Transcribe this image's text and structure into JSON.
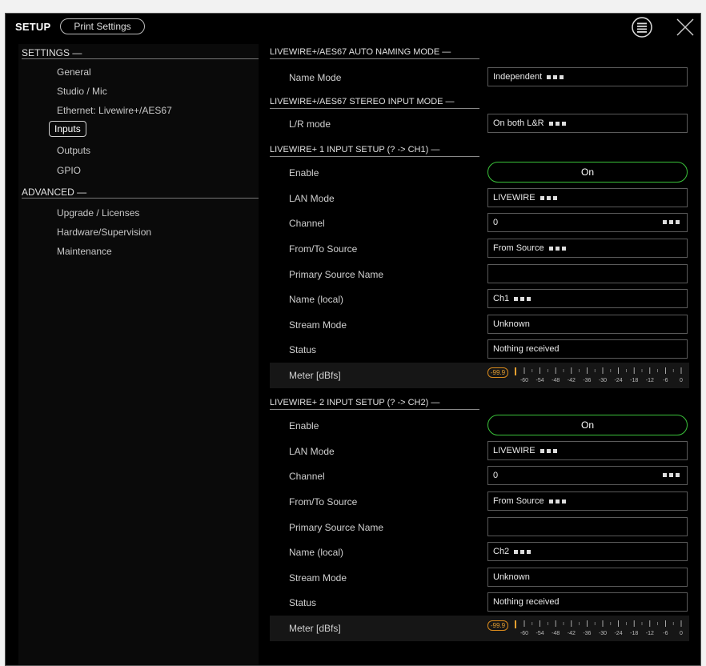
{
  "header": {
    "title": "SETUP",
    "print_label": "Print Settings"
  },
  "sidebar": {
    "settings_label": "SETTINGS —",
    "settings_items": [
      "General",
      "Studio / Mic",
      "Ethernet: Livewire+/AES67",
      "Inputs",
      "Outputs",
      "GPIO"
    ],
    "advanced_label": "ADVANCED —",
    "advanced_items": [
      "Upgrade / Licenses",
      "Hardware/Supervision",
      "Maintenance"
    ],
    "active_item": "Inputs"
  },
  "sections": {
    "naming": {
      "title": "LIVEWIRE+/AES67 AUTO NAMING MODE —",
      "name_mode_label": "Name Mode",
      "name_mode_value": "Independent"
    },
    "stereo": {
      "title": "LIVEWIRE+/AES67 STEREO INPUT MODE —",
      "lr_label": "L/R mode",
      "lr_value": "On both L&R"
    }
  },
  "inputs": [
    {
      "title": "LIVEWIRE+ 1 INPUT SETUP (? -> CH1) —",
      "enable_label": "Enable",
      "enable_value": "On",
      "lan_label": "LAN Mode",
      "lan_value": "LIVEWIRE",
      "channel_label": "Channel",
      "channel_value": "0",
      "fromto_label": "From/To Source",
      "fromto_value": "From Source",
      "primary_label": "Primary Source Name",
      "primary_value": "",
      "name_label": "Name (local)",
      "name_value": "Ch1",
      "stream_label": "Stream Mode",
      "stream_value": "Unknown",
      "status_label": "Status",
      "status_value": "Nothing received",
      "meter_label": "Meter [dBfs]",
      "meter_value": "-99.9"
    },
    {
      "title": "LIVEWIRE+ 2 INPUT SETUP (? -> CH2) —",
      "enable_label": "Enable",
      "enable_value": "On",
      "lan_label": "LAN Mode",
      "lan_value": "LIVEWIRE",
      "channel_label": "Channel",
      "channel_value": "0",
      "fromto_label": "From/To Source",
      "fromto_value": "From Source",
      "primary_label": "Primary Source Name",
      "primary_value": "",
      "name_label": "Name (local)",
      "name_value": "Ch2",
      "stream_label": "Stream Mode",
      "stream_value": "Unknown",
      "status_label": "Status",
      "status_value": "Nothing received",
      "meter_label": "Meter [dBfs]",
      "meter_value": "-99.9"
    }
  ],
  "meter_scale": [
    "-60",
    "-54",
    "-48",
    "-42",
    "-36",
    "-30",
    "-24",
    "-18",
    "-12",
    "-6",
    "0"
  ],
  "colors": {
    "toggle_border": "#3ac23a",
    "meter_value": "#e8a030",
    "background": "#000000"
  },
  "icons": {
    "menu": "list-menu-icon",
    "close": "close-icon"
  }
}
